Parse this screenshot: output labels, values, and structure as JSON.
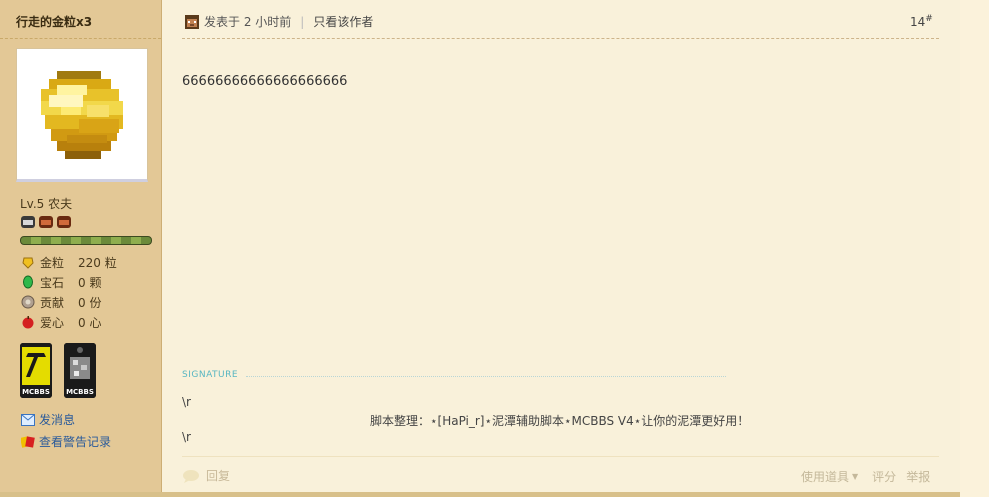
{
  "user": {
    "name": "行走的金粒x3",
    "level": "Lv.5 农夫",
    "stats": [
      {
        "icon": "gold-nugget-icon",
        "label": "金粒",
        "value": "220 粒"
      },
      {
        "icon": "emerald-gem-icon",
        "label": "宝石",
        "value": "0 颗"
      },
      {
        "icon": "contribution-icon",
        "label": "贡献",
        "value": "0 份"
      },
      {
        "icon": "apple-heart-icon",
        "label": "爱心",
        "value": "0 心"
      }
    ],
    "badges": [
      {
        "text": "MCBBS",
        "color": "#e8e000"
      },
      {
        "text": "MCBBS",
        "color": "#2a2a2a"
      }
    ],
    "send_message": "发消息",
    "view_warnings": "查看警告记录"
  },
  "post": {
    "posted": "发表于 2 小时前",
    "only_author": "只看该作者",
    "floor": "14",
    "floor_mark": "#",
    "content": "66666666666666666666"
  },
  "signature": {
    "label": "SIGNATURE",
    "line1": "\\r",
    "line2": "脚本整理：⋆[HaPi_r]⋆泥潭辅助脚本⋆MCBBS V4⋆让你的泥潭更好用！",
    "line3": "\\r"
  },
  "footer": {
    "reply": "回复",
    "use_item": "使用道具",
    "rate": "评分",
    "report": "举报"
  },
  "colors": {
    "sidebar_bg": "#e3c896",
    "content_bg": "#f9f1da",
    "link": "#2a5a9a",
    "signature_label": "#58b6c2"
  }
}
